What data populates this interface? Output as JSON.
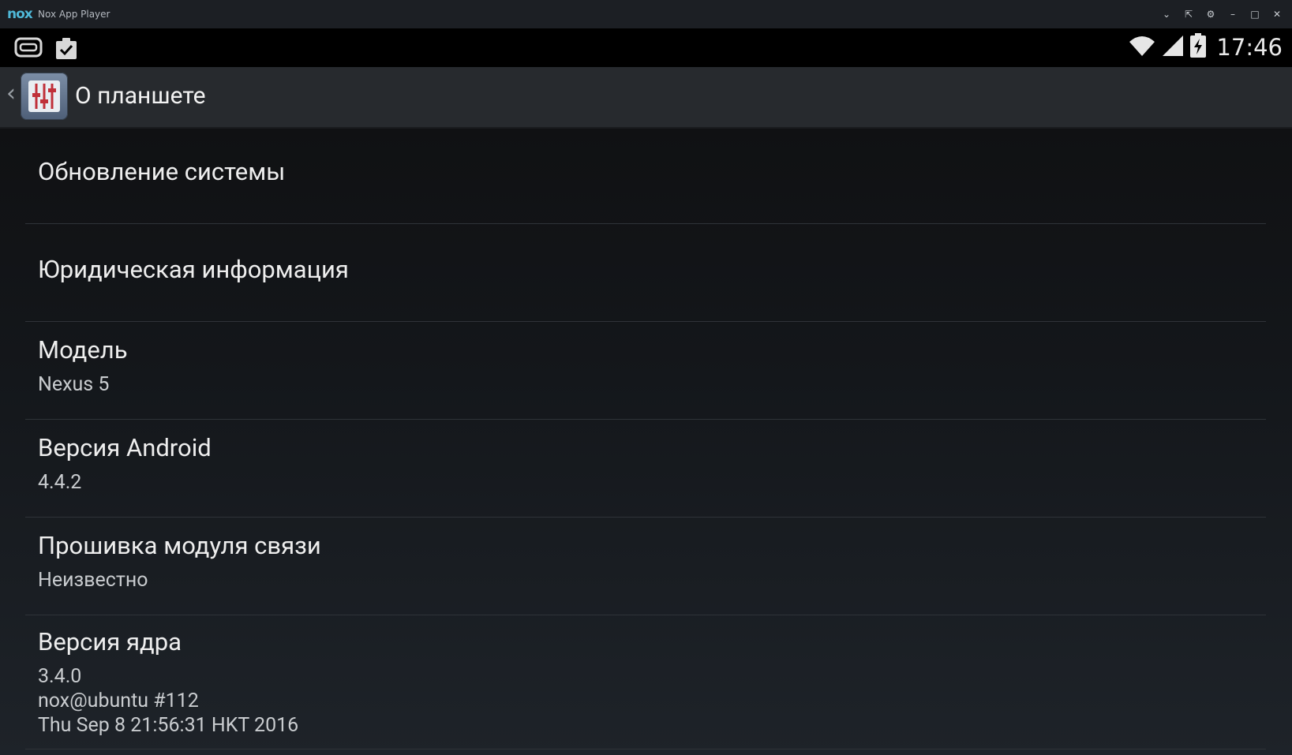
{
  "window": {
    "logo_text": "nox",
    "title": "Nox App Player",
    "controls": [
      {
        "name": "chevron-down",
        "glyph": "⌄"
      },
      {
        "name": "pin",
        "glyph": "⇱"
      },
      {
        "name": "settings",
        "glyph": "⚙"
      },
      {
        "name": "minimize",
        "glyph": "–"
      },
      {
        "name": "maximize",
        "glyph": "□"
      },
      {
        "name": "close",
        "glyph": "✕"
      }
    ]
  },
  "statusbar": {
    "left_icons": [
      "gamepad-icon",
      "clipboard-check-icon"
    ],
    "right_icons": [
      "wifi-icon",
      "cell-signal-icon",
      "battery-charging-icon"
    ],
    "time": "17:46"
  },
  "actionbar": {
    "back_icon": "chevron-left-icon",
    "app_icon": "settings-sliders-icon",
    "title": "О планшете"
  },
  "items": [
    {
      "title": "Обновление системы"
    },
    {
      "title": "Юридическая информация"
    },
    {
      "title": "Модель",
      "sub": [
        "Nexus 5"
      ]
    },
    {
      "title": "Версия Android",
      "sub": [
        "4.4.2"
      ]
    },
    {
      "title": "Прошивка модуля связи",
      "sub": [
        "Неизвестно"
      ]
    },
    {
      "title": "Версия ядра",
      "sub": [
        "3.4.0",
        "nox@ubuntu #112",
        "Thu Sep 8 21:56:31 HKT 2016"
      ]
    }
  ],
  "colors": {
    "accent": "#4fb8d8",
    "background": "#0e0f11",
    "text": "#eeeeee"
  }
}
